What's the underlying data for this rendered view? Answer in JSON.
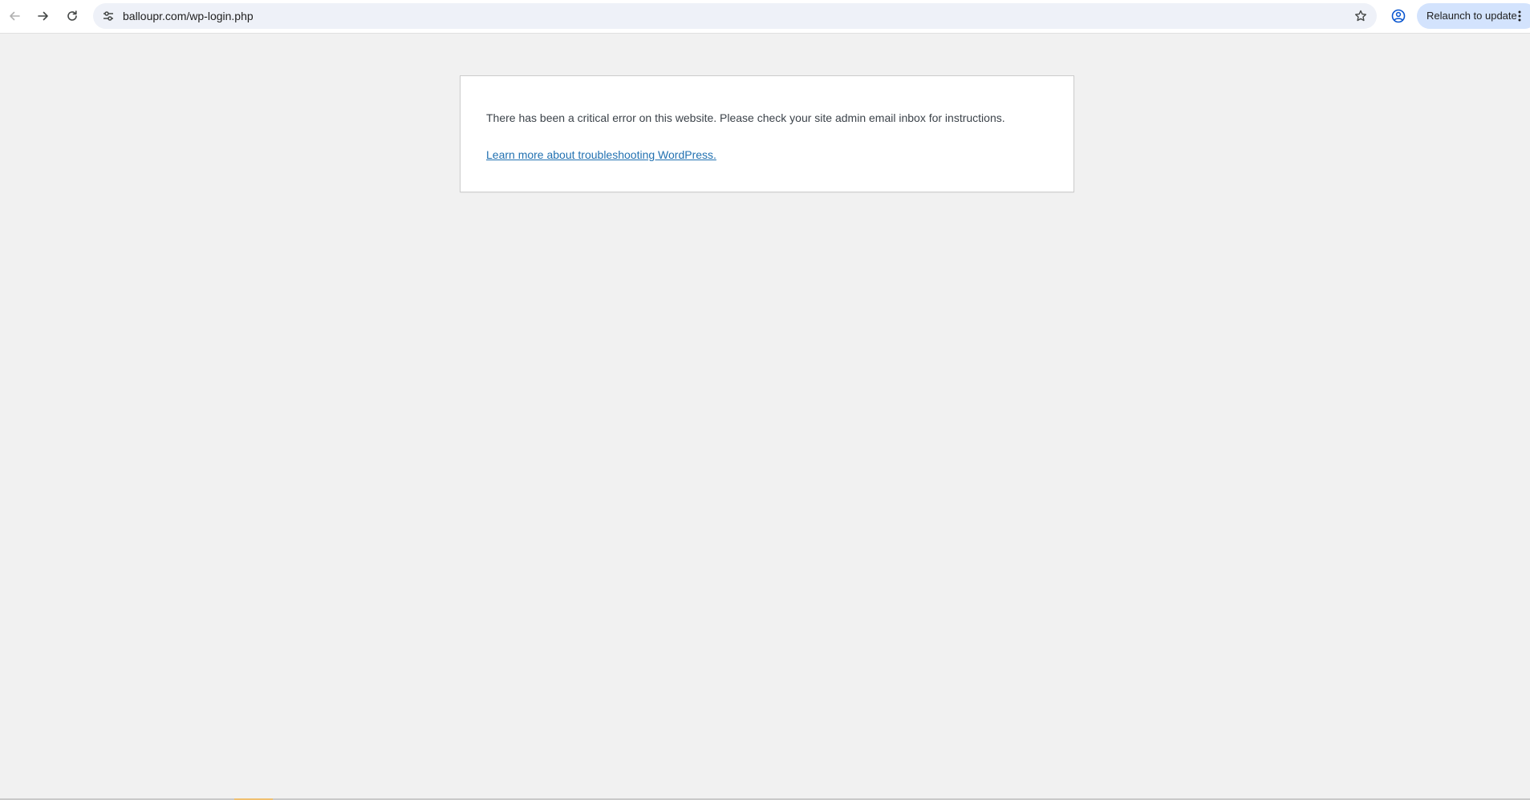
{
  "browser": {
    "url": "balloupr.com/wp-login.php",
    "relaunch_label": "Relaunch to update",
    "icons": {
      "back": "arrow-left-icon",
      "forward": "arrow-right-icon",
      "reload": "reload-icon",
      "site_info": "tune-icon",
      "bookmark": "star-icon",
      "profile": "account-circle-icon",
      "menu": "more-vert-icon"
    }
  },
  "page": {
    "error_message": "There has been a critical error on this website. Please check your site admin email inbox for instructions.",
    "help_link": "Learn more about troubleshooting WordPress."
  },
  "colors": {
    "page_background": "#f1f1f1",
    "link": "#2271b1",
    "text": "#3c434a",
    "omnibox": "#eef1f8",
    "relaunch_button": "#d3e3fd"
  }
}
